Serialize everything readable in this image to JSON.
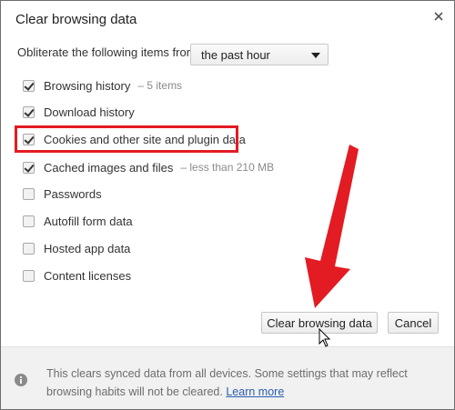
{
  "dialog": {
    "title": "Clear browsing data"
  },
  "period": {
    "label": "Obliterate the following items from:",
    "selected": "the past hour"
  },
  "items": [
    {
      "label": "Browsing history",
      "detail": "–  5 items",
      "checked": true
    },
    {
      "label": "Download history",
      "detail": "",
      "checked": true
    },
    {
      "label": "Cookies and other site and plugin data",
      "detail": "",
      "checked": true
    },
    {
      "label": "Cached images and files",
      "detail": "–  less than 210 MB",
      "checked": true
    },
    {
      "label": "Passwords",
      "detail": "",
      "checked": false
    },
    {
      "label": "Autofill form data",
      "detail": "",
      "checked": false
    },
    {
      "label": "Hosted app data",
      "detail": "",
      "checked": false
    },
    {
      "label": "Content licenses",
      "detail": "",
      "checked": false
    }
  ],
  "buttons": {
    "clear": "Clear browsing data",
    "cancel": "Cancel"
  },
  "footer": {
    "text": "This clears synced data from all devices. Some settings that may reflect browsing habits will not be cleared.",
    "link": "Learn more"
  },
  "colors": {
    "highlight": "#e31b23",
    "link": "#2a5db0",
    "footer_bg": "#f1f1f1"
  },
  "icons": {
    "close": "close-icon",
    "info": "info-icon",
    "dropdown": "chevron-down-icon",
    "arrow": "red-arrow-annotation",
    "cursor": "mouse-pointer"
  }
}
